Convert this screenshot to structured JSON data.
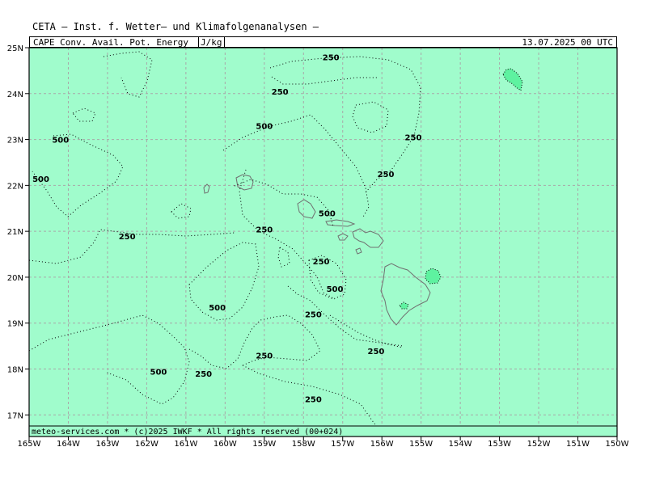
{
  "header": {
    "title": "CETA — Inst. f. Wetter— und Klimafolgenanalysen —",
    "product": "CAPE_Conv._Avail._Pot._Energy_",
    "unit": "J/kg",
    "valid_time": "13.07.2025 00 UTC"
  },
  "footer": {
    "credit": "meteo-services.com * (c)2025 IWKF * All rights reserved (00+024)"
  },
  "map": {
    "region": "Hawaiian Islands, Central North Pacific",
    "lon_range": [
      -165,
      -150
    ],
    "lat_range": [
      16.6,
      25
    ],
    "background_color": "#a0fccc",
    "cell_color": "#5ef2a0",
    "coastline_color": "#707070",
    "grid": true,
    "lon_labels": [
      "165W",
      "164W",
      "163W",
      "162W",
      "161W",
      "160W",
      "159W",
      "158W",
      "157W",
      "156W",
      "155W",
      "154W",
      "153W",
      "152W",
      "151W",
      "150W"
    ],
    "lat_labels": [
      "25N",
      "24N",
      "23N",
      "22N",
      "21N",
      "20N",
      "19N",
      "18N",
      "17N"
    ],
    "contour_levels": [
      250,
      500
    ],
    "contour_labels": [
      {
        "text": "250",
        "lon": -157.3,
        "lat": 24.8
      },
      {
        "text": "250",
        "lon": -158.6,
        "lat": 24.05
      },
      {
        "text": "500",
        "lon": -159.0,
        "lat": 23.3
      },
      {
        "text": "500",
        "lon": -164.2,
        "lat": 23.0
      },
      {
        "text": "250",
        "lon": -155.2,
        "lat": 23.05
      },
      {
        "text": "500",
        "lon": -164.7,
        "lat": 22.15
      },
      {
        "text": "250",
        "lon": -155.9,
        "lat": 22.25
      },
      {
        "text": "500",
        "lon": -157.4,
        "lat": 21.4
      },
      {
        "text": "250",
        "lon": -159.0,
        "lat": 21.05
      },
      {
        "text": "250",
        "lon": -162.5,
        "lat": 20.9
      },
      {
        "text": "250",
        "lon": -157.55,
        "lat": 20.35
      },
      {
        "text": "500",
        "lon": -157.2,
        "lat": 19.75
      },
      {
        "text": "500",
        "lon": -160.2,
        "lat": 19.35
      },
      {
        "text": "250",
        "lon": -157.75,
        "lat": 19.2
      },
      {
        "text": "250",
        "lon": -159.0,
        "lat": 18.3
      },
      {
        "text": "250",
        "lon": -156.15,
        "lat": 18.4
      },
      {
        "text": "500",
        "lon": -161.7,
        "lat": 17.95
      },
      {
        "text": "250",
        "lon": -160.55,
        "lat": 17.9
      },
      {
        "text": "250",
        "lon": -157.75,
        "lat": 17.35
      }
    ]
  }
}
